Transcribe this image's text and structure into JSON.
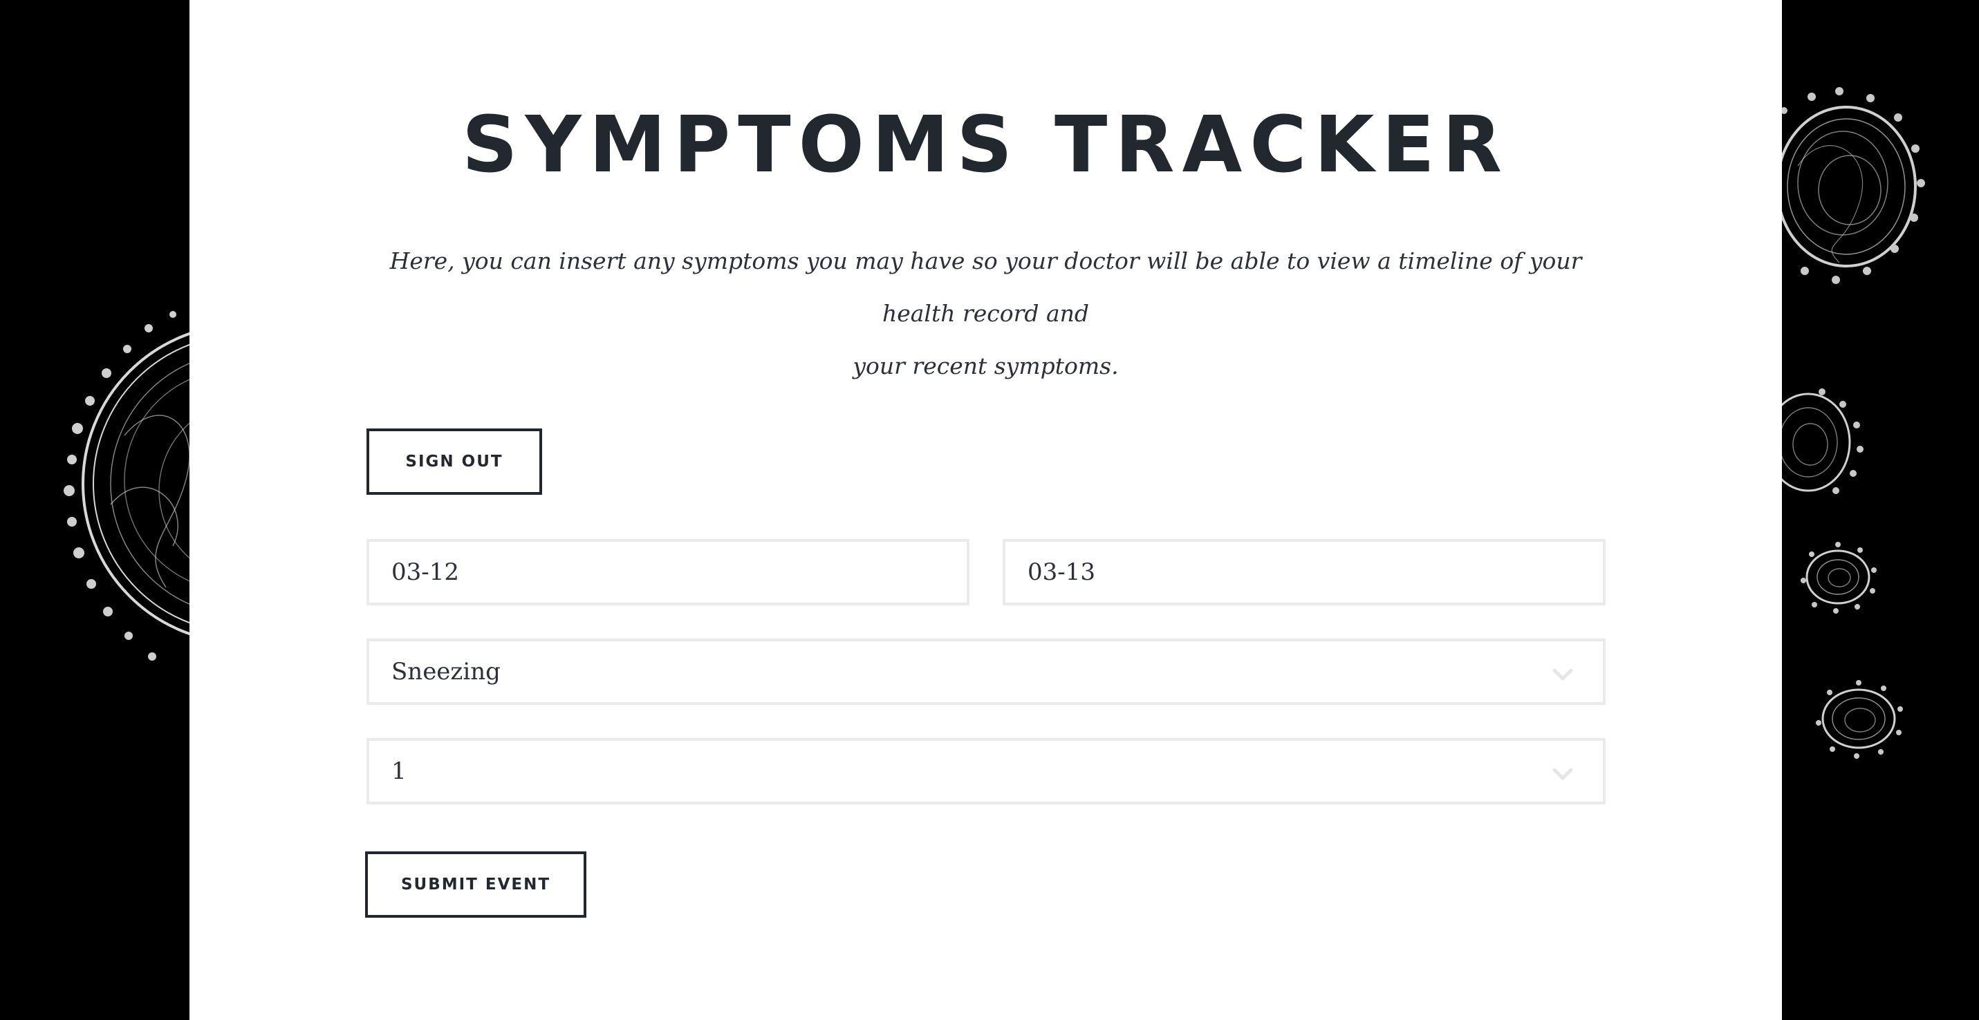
{
  "header": {
    "title": "SYMPTOMS TRACKER",
    "intro_line_1": "Here, you can insert any symptoms you may have so your doctor will be able to view a timeline of your health record and",
    "intro_line_2": "your recent symptoms."
  },
  "actions": {
    "sign_out_label": "SIGN OUT",
    "submit_label": "SUBMIT EVENT"
  },
  "form": {
    "start_date_value": "03-12",
    "end_date_value": "03-13",
    "symptom_selected": "Sneezing",
    "severity_selected": "1"
  },
  "icons": {
    "symptom_dropdown": "chevron-down-icon",
    "severity_dropdown": "chevron-down-icon",
    "background_decoration": "virus-icon"
  },
  "colors": {
    "page_background": "#000000",
    "panel_background": "#ffffff",
    "text_primary": "#23272e",
    "field_border": "#ebebeb"
  }
}
